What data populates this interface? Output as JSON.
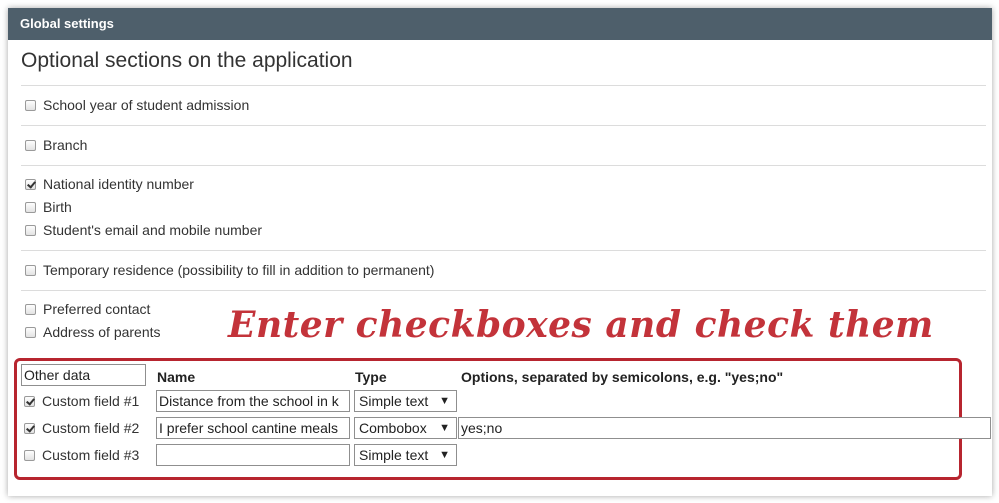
{
  "header": {
    "title": "Global settings"
  },
  "section": {
    "title": "Optional sections on the application"
  },
  "options": {
    "school_year": {
      "label": "School year of student admission",
      "checked": false
    },
    "branch": {
      "label": "Branch",
      "checked": false
    },
    "national_id": {
      "label": "National identity number",
      "checked": true
    },
    "birth": {
      "label": "Birth",
      "checked": false
    },
    "email_mobile": {
      "label": "Student's email and mobile number",
      "checked": false
    },
    "temp_residence": {
      "label": "Temporary residence (possibility to fill in addition to permanent)",
      "checked": false
    },
    "preferred_contact": {
      "label": "Preferred contact",
      "checked": false
    },
    "address_parents": {
      "label": "Address of parents",
      "checked": false
    }
  },
  "annotation": {
    "text": "Enter checkboxes and check them"
  },
  "custom_fields": {
    "section_input": "Other data",
    "headers": {
      "name": "Name",
      "type": "Type",
      "options": "Options, separated by semicolons, e.g. \"yes;no\""
    },
    "rows": [
      {
        "label": "Custom field #1",
        "checked": true,
        "name": "Distance from the school in k",
        "type": "Simple text",
        "options": ""
      },
      {
        "label": "Custom field #2",
        "checked": true,
        "name": "I prefer school cantine meals",
        "type": "Combobox",
        "options": "yes;no"
      },
      {
        "label": "Custom field #3",
        "checked": false,
        "name": "",
        "type": "Simple text",
        "options": ""
      }
    ]
  },
  "colors": {
    "header_bg": "#4e5f6b",
    "annotation": "#c3333a",
    "annotation_box": "#b7252f"
  },
  "icons": {
    "select_arrow": "dropdown-arrow-icon",
    "checkbox": "checkbox-icon"
  }
}
